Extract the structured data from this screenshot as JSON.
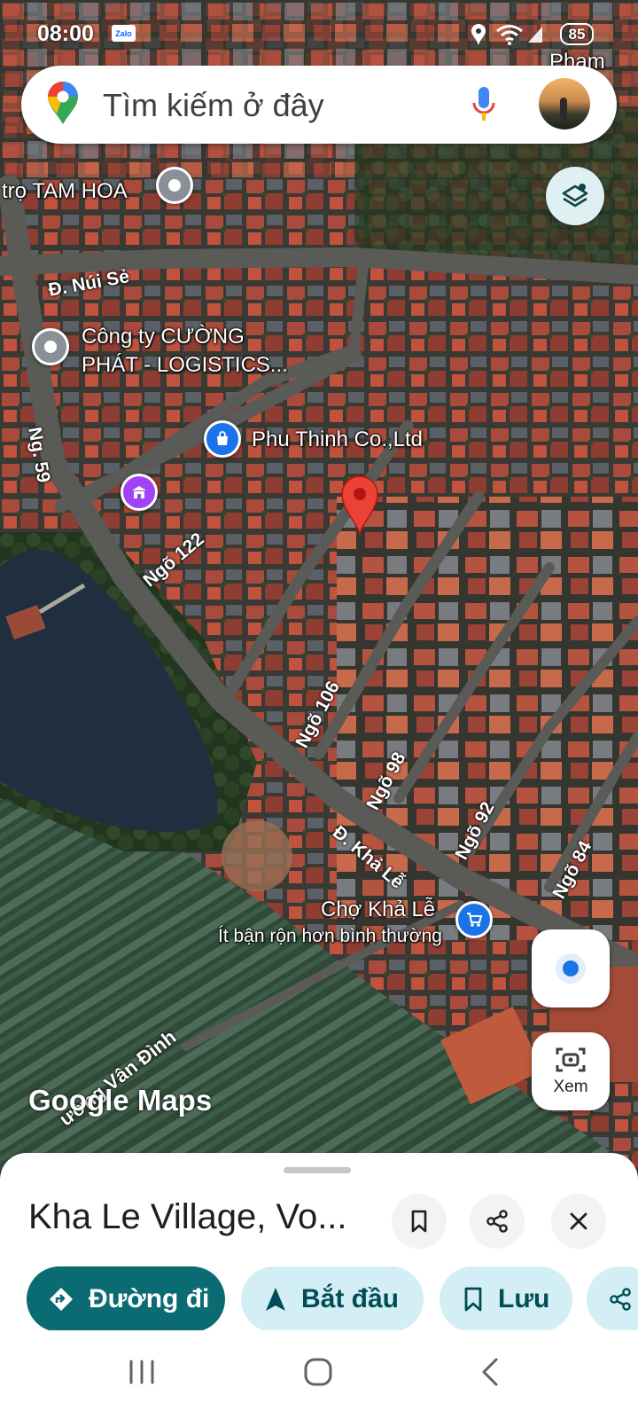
{
  "status_bar": {
    "time": "08:00",
    "zalo_label": "Zalo",
    "battery": "85",
    "icons": [
      "zalo-icon",
      "location-icon",
      "wifi-icon",
      "signal-icon",
      "battery-icon"
    ]
  },
  "search": {
    "placeholder": "Tìm kiếm ở đây",
    "icons": [
      "google-maps-pin-icon",
      "microphone-icon",
      "avatar"
    ]
  },
  "map": {
    "labels": {
      "pham": "Pham",
      "tam_hoa": "trọ TAM HOA",
      "cuong_phat_1": "Công ty CƯỜNG",
      "cuong_phat_2": "PHÁT - LOGISTICS...",
      "phu_thinh": "Phu Thinh Co.,Ltd",
      "cho_kha_le": "Chợ Khả Lễ",
      "cho_kha_le_status": "Ít bận rộn hơn bình thường"
    },
    "roads": {
      "nui_se": "Đ. Núi Sẻ",
      "ng59": "Ng. 59",
      "ngo122": "Ngõ 122",
      "ngo106": "Ngõ 106",
      "ngo98": "Ngõ 98",
      "kha_le": "Đ. Khả Lễ",
      "ngo92": "Ngõ 92",
      "ngo84": "Ngõ 84",
      "van_dinh": "ường Vân Đình"
    },
    "logo": "Google Maps",
    "colors": {
      "selected_pin": "#ea4335",
      "shop_pin": "#1a73e8",
      "temple_pin": "#a142f4",
      "location_dot": "#1a73e8"
    }
  },
  "controls": {
    "view_label": "Xem"
  },
  "sheet": {
    "title": "Kha Le Village, Vo...",
    "actions": {
      "directions": "Đường đi",
      "start": "Bắt đầu",
      "save": "Lưu"
    },
    "colors": {
      "primary": "#0b6b73",
      "chip": "#d3eef4"
    }
  },
  "nav": {
    "icons": [
      "recent-apps-icon",
      "home-icon",
      "back-icon"
    ]
  }
}
